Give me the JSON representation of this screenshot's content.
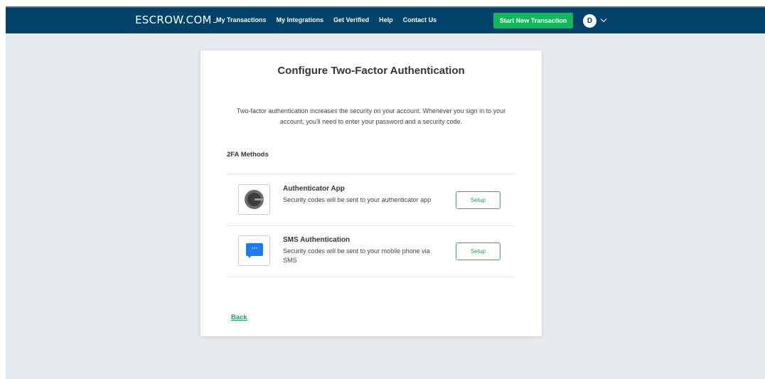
{
  "header": {
    "logo": "ESCROW.COM",
    "nav": [
      "My Transactions",
      "My Integrations",
      "Get Verified",
      "Help",
      "Contact Us"
    ],
    "start_button": "Start New Transaction",
    "user_initial": "D"
  },
  "card": {
    "title": "Configure Two-Factor Authentication",
    "description": "Two-factor authentication increases the security on your account. Whenever you sign in to your account, you'll need to enter your password and a security code.",
    "section_label": "2FA Methods",
    "methods": [
      {
        "title": "Authenticator App",
        "description": "Security codes will be sent to your authenticator app",
        "button": "Setup",
        "icon": "google-authenticator-icon"
      },
      {
        "title": "SMS Authentication",
        "description": "Security codes will be sent to your mobile phone via SMS",
        "button": "Setup",
        "icon": "sms-chat-bubble-icon",
        "icon_glyph": "···"
      }
    ],
    "back_label": "Back"
  },
  "colors": {
    "navbar": "#01426a",
    "accent_green": "#12b757",
    "page_background": "#e6e9f0",
    "sms_blue": "#1a7cf0"
  }
}
